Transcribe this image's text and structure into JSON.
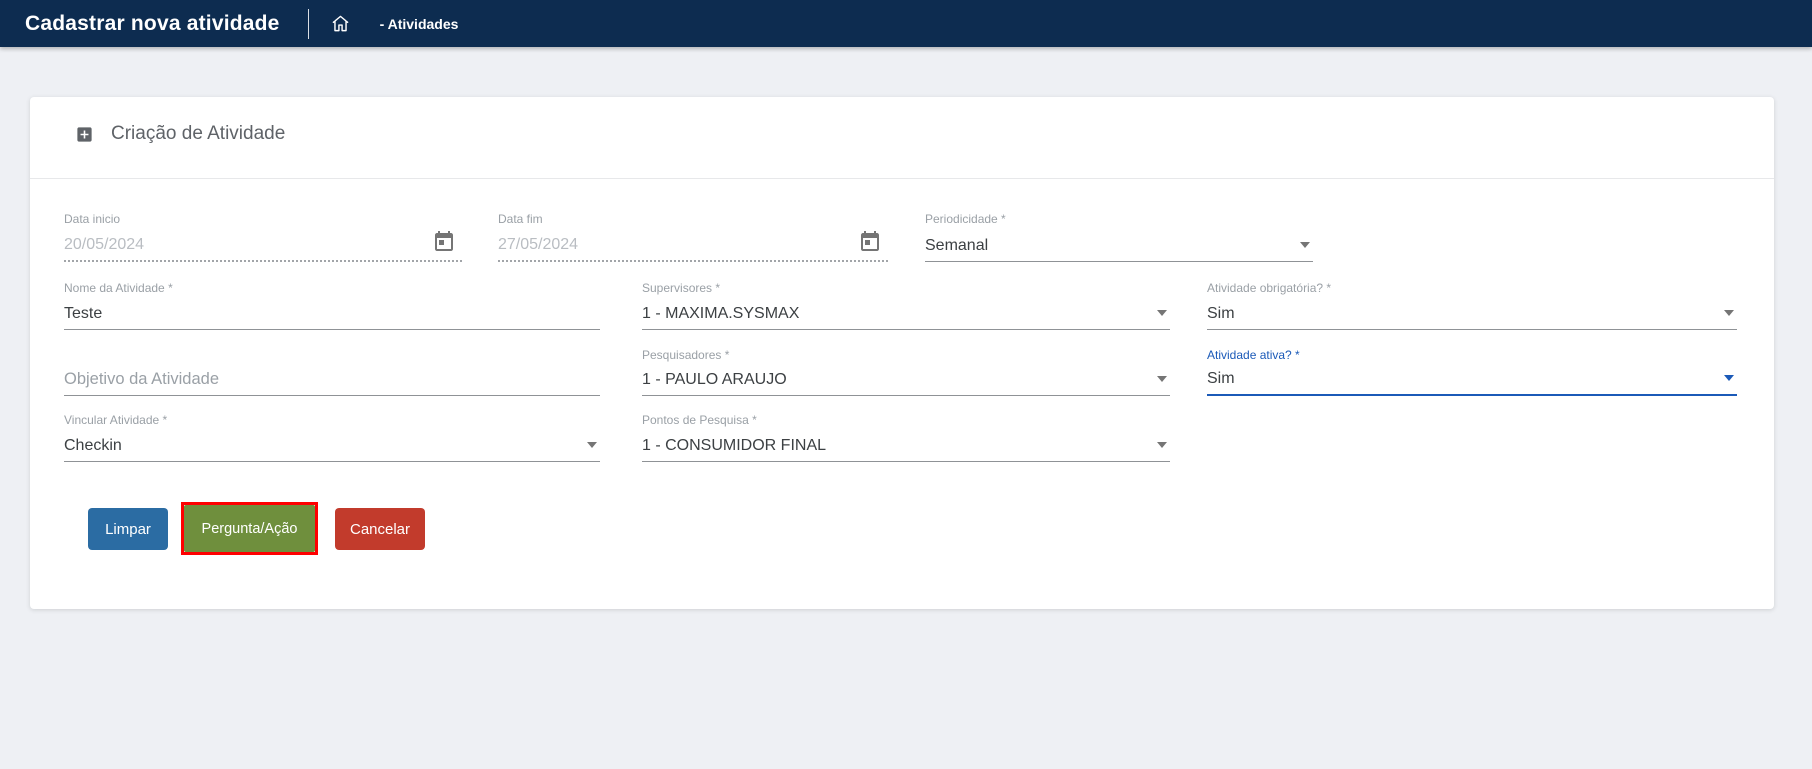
{
  "navbar": {
    "title": "Cadastrar nova atividade",
    "breadcrumb": "- Atividades"
  },
  "card": {
    "title": "Criação de Atividade"
  },
  "fields": {
    "data_inicio": {
      "label": "Data inicio",
      "value": "20/05/2024",
      "disabled": true
    },
    "data_fim": {
      "label": "Data fim",
      "value": "27/05/2024",
      "disabled": true
    },
    "periodicidade": {
      "label": "Periodicidade *",
      "value": "Semanal"
    },
    "nome": {
      "label": "Nome da Atividade *",
      "value": "Teste"
    },
    "supervisores": {
      "label": "Supervisores *",
      "value": "1 - MAXIMA.SYSMAX"
    },
    "obrigatoria": {
      "label": "Atividade obrigatória? *",
      "value": "Sim"
    },
    "objetivo": {
      "placeholder": "Objetivo da Atividade",
      "value": ""
    },
    "pesquisadores": {
      "label": "Pesquisadores *",
      "value": "1 - PAULO ARAUJO"
    },
    "ativa": {
      "label": "Atividade ativa? *",
      "value": "Sim",
      "focused": true
    },
    "vincular": {
      "label": "Vincular Atividade *",
      "value": "Checkin"
    },
    "pontos": {
      "label": "Pontos de Pesquisa *",
      "value": "1 - CONSUMIDOR FINAL"
    }
  },
  "buttons": {
    "limpar": "Limpar",
    "pergunta": "Pergunta/Ação",
    "cancelar": "Cancelar"
  },
  "icons": {
    "home": "home-outline",
    "add_box": "plus-in-square",
    "calendar": "calendar-with-day",
    "dropdown": "filled-down-triangle"
  },
  "colors": {
    "navbar_bg": "#0d2c50",
    "page_bg": "#eef0f4",
    "focus_blue": "#1b5ab8",
    "btn_limpar": "#2b6ca3",
    "btn_pergunta": "#6f8f3d",
    "btn_cancelar": "#c23b2c",
    "highlight_border": "#fe0000",
    "label_gray": "#9aa0a6",
    "value_gray": "#3c4043"
  }
}
